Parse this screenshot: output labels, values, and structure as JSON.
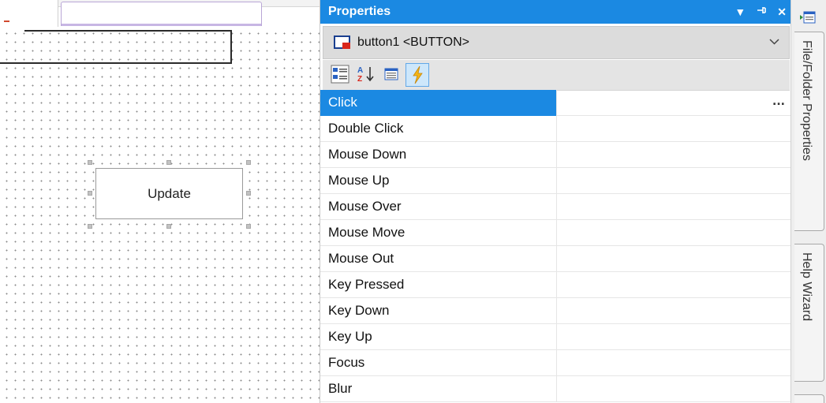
{
  "designer": {
    "button_label": "Update"
  },
  "properties_panel": {
    "title": "Properties",
    "title_buttons": {
      "dropdown": "▼",
      "pin": "ᵽ",
      "close": "✕"
    },
    "selected_object": "button1 <BUTTON>",
    "toolbar": [
      {
        "icon": "categorized-icon",
        "active": false
      },
      {
        "icon": "alphabetical-sort-icon",
        "active": false
      },
      {
        "icon": "property-pages-icon",
        "active": false
      },
      {
        "icon": "events-lightning-icon",
        "active": true
      }
    ],
    "events": [
      {
        "name": "Click",
        "value": "",
        "selected": true
      },
      {
        "name": "Double Click",
        "value": ""
      },
      {
        "name": "Mouse Down",
        "value": ""
      },
      {
        "name": "Mouse Up",
        "value": ""
      },
      {
        "name": "Mouse Over",
        "value": ""
      },
      {
        "name": "Mouse Move",
        "value": ""
      },
      {
        "name": "Mouse Out",
        "value": ""
      },
      {
        "name": "Key Pressed",
        "value": ""
      },
      {
        "name": "Key Down",
        "value": ""
      },
      {
        "name": "Key Up",
        "value": ""
      },
      {
        "name": "Focus",
        "value": ""
      },
      {
        "name": "Blur",
        "value": ""
      }
    ],
    "ellipsis": "..."
  },
  "side_tabs": [
    {
      "label": "File/Folder Properties"
    },
    {
      "label": "Help Wizard"
    }
  ],
  "colors": {
    "accent": "#1b89e2",
    "selection_text": "#ffffff"
  }
}
